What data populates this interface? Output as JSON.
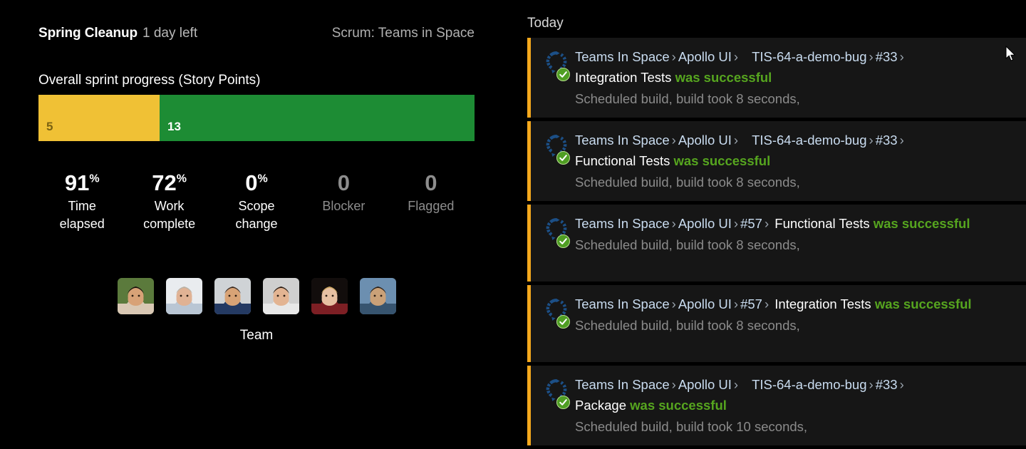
{
  "sprint": {
    "name": "Spring Cleanup",
    "days_left": "1 day left",
    "board": "Scrum: Teams in Space",
    "progress_label": "Overall sprint progress (Story Points)",
    "progress": {
      "remaining_value": "5",
      "done_value": "13",
      "remaining_color": "#f0c135",
      "done_color": "#1d8c34"
    },
    "stats": [
      {
        "value": "91",
        "suffix": "%",
        "label_line1": "Time",
        "label_line2": "elapsed",
        "muted": false
      },
      {
        "value": "72",
        "suffix": "%",
        "label_line1": "Work",
        "label_line2": "complete",
        "muted": false
      },
      {
        "value": "0",
        "suffix": "%",
        "label_line1": "Scope",
        "label_line2": "change",
        "muted": false
      },
      {
        "value": "0",
        "suffix": "",
        "label_line1": "Blocker",
        "label_line2": "",
        "muted": true
      },
      {
        "value": "0",
        "suffix": "",
        "label_line1": "Flagged",
        "label_line2": "",
        "muted": true
      }
    ],
    "team": {
      "label": "Team",
      "members": [
        {
          "icon": "avatar-photo-1"
        },
        {
          "icon": "avatar-photo-2"
        },
        {
          "icon": "avatar-photo-3"
        },
        {
          "icon": "avatar-photo-4"
        },
        {
          "icon": "avatar-photo-5"
        },
        {
          "icon": "avatar-photo-6"
        }
      ]
    }
  },
  "feed": {
    "heading": "Today",
    "accent_color": "#f4a81d",
    "success_color": "#56a51f",
    "link_color": "#c9dcf0",
    "items": [
      {
        "crumbs": [
          "Teams In Space",
          "Apollo UI",
          "TIS-64-a-demo-bug",
          "#33"
        ],
        "gap_after_index": 1,
        "trailing_sep": true,
        "job": "Integration Tests",
        "status": "was successful",
        "meta": "Scheduled build, build took 8 seconds,",
        "build_icon": "build-refresh-icon",
        "status_icon": "check-circle-icon"
      },
      {
        "crumbs": [
          "Teams In Space",
          "Apollo UI",
          "TIS-64-a-demo-bug",
          "#33"
        ],
        "gap_after_index": 1,
        "trailing_sep": true,
        "job": "Functional Tests",
        "status": "was successful",
        "meta": "Scheduled build, build took 8 seconds,",
        "build_icon": "build-refresh-icon",
        "status_icon": "check-circle-icon"
      },
      {
        "crumbs": [
          "Teams In Space",
          "Apollo UI",
          "#57"
        ],
        "gap_after_index": -1,
        "trailing_sep": true,
        "job": "Functional Tests",
        "status": "was successful",
        "meta": "Scheduled build, build took 8 seconds,",
        "inline_job": true,
        "build_icon": "build-refresh-icon",
        "status_icon": "check-circle-icon"
      },
      {
        "crumbs": [
          "Teams In Space",
          "Apollo UI",
          "#57"
        ],
        "gap_after_index": -1,
        "trailing_sep": true,
        "job": "Integration Tests",
        "status": "was successful",
        "meta": "Scheduled build, build took 8 seconds,",
        "inline_job": true,
        "build_icon": "build-refresh-icon",
        "status_icon": "check-circle-icon"
      },
      {
        "crumbs": [
          "Teams In Space",
          "Apollo UI",
          "TIS-64-a-demo-bug",
          "#33"
        ],
        "gap_after_index": 1,
        "trailing_sep": true,
        "job": "Package",
        "status": "was successful",
        "meta": "Scheduled build, build took 10 seconds,",
        "build_icon": "build-refresh-icon",
        "status_icon": "check-circle-icon"
      }
    ]
  },
  "cursor": {
    "icon": "mouse-pointer-icon"
  }
}
